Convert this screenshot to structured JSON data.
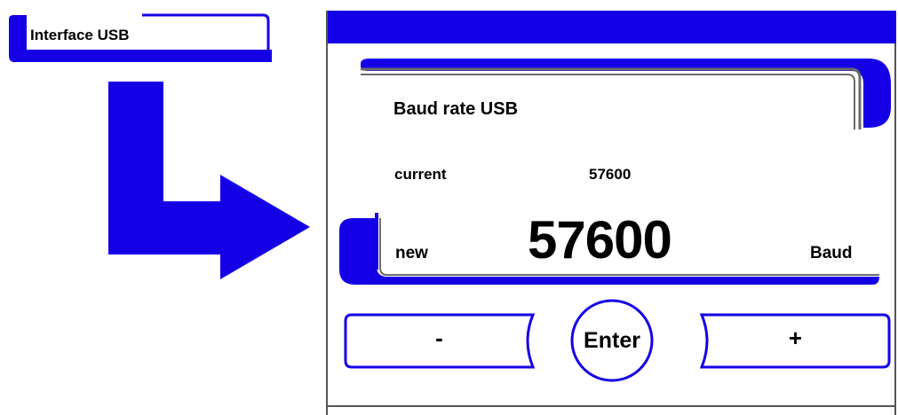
{
  "menu_item": {
    "label": "Interface USB"
  },
  "screen": {
    "title": "Baud rate USB",
    "current_label": "current",
    "current_value": "57600",
    "new_label": "new",
    "new_value": "57600",
    "unit": "Baud",
    "buttons": {
      "minus": "-",
      "enter": "Enter",
      "plus": "+"
    }
  },
  "colors": {
    "accent": "#1500e6",
    "frame_gray": "#6b6b6b"
  }
}
